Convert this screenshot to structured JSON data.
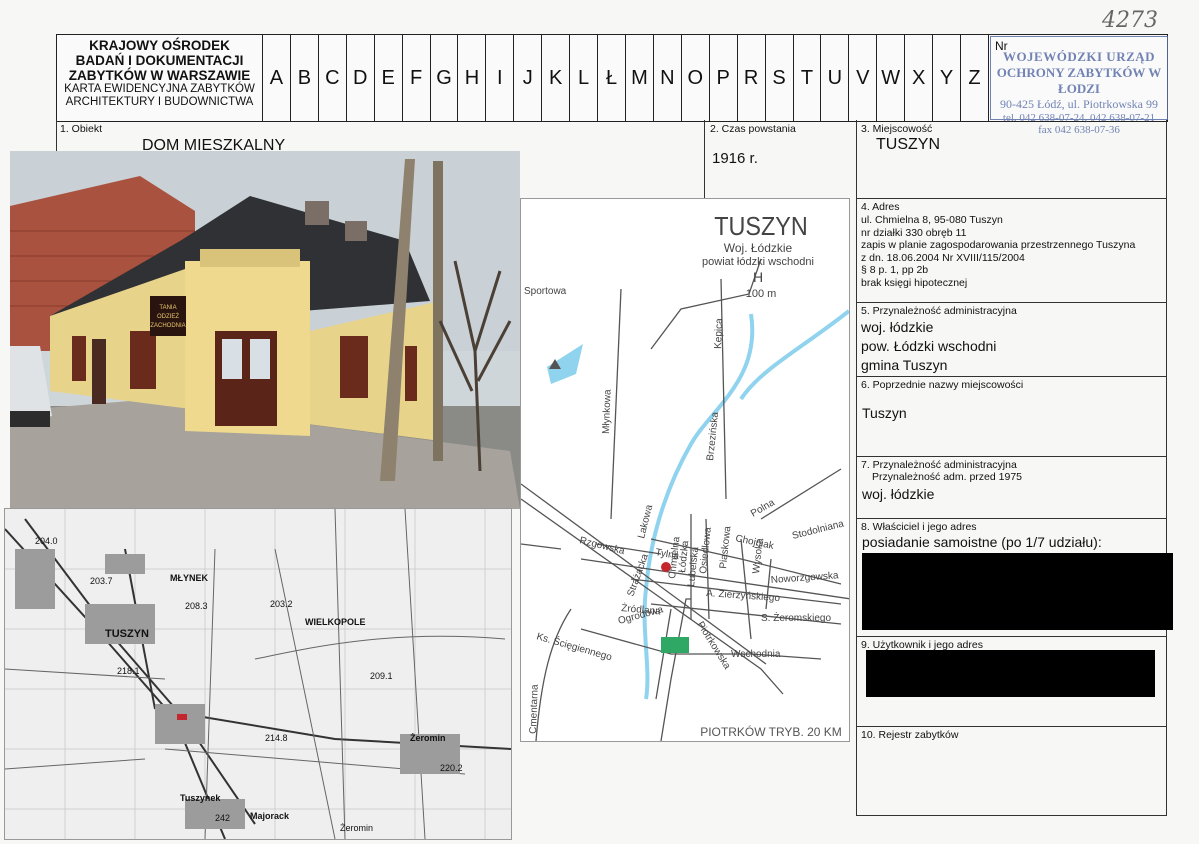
{
  "handwritten_number": "4273",
  "header": {
    "title_lines": [
      "KRAJOWY OŚRODEK",
      "BADAŃ I DOKUMENTACJI",
      "ZABYTKÓW W WARSZAWIE"
    ],
    "subtitle_lines": [
      "KARTA EWIDENCYJNA ZABYTKÓW",
      "ARCHITEKTURY I BUDOWNICTWA"
    ],
    "letters": [
      "A",
      "B",
      "C",
      "D",
      "E",
      "F",
      "G",
      "H",
      "I",
      "J",
      "K",
      "L",
      "Ł",
      "M",
      "N",
      "O",
      "P",
      "R",
      "S",
      "T",
      "U",
      "V",
      "W",
      "X",
      "Y",
      "Z"
    ],
    "nr_label": "Nr"
  },
  "stamp": {
    "line1": "WOJEWÓDZKI URZĄD",
    "line2": "OCHRONY ZABYTKÓW W ŁODZI",
    "line3": "90-425 Łódź, ul. Piotrkowska 99",
    "line4": "tel. 042 638-07-24, 042 638-07-21",
    "line5": "fax 042 638-07-36"
  },
  "fields": {
    "f1_label": "1. Obiekt",
    "f1_value": "DOM MIESZKALNY",
    "f2_label": "2. Czas powstania",
    "f2_value": "1916 r.",
    "f3_label": "3. Miejscowość",
    "f3_value": "TUSZYN",
    "f4_label": "4. Adres",
    "f4_lines": [
      "ul. Chmielna  8, 95-080 Tuszyn",
      "nr działki 330 obręb 11",
      "zapis w planie zagospodarowania przestrzennego Tuszyna",
      "z dn. 18.06.2004 Nr XVIII/115/2004",
      "§ 8 p. 1, pp 2b",
      "brak  księgi  hipotecznej"
    ],
    "f5_label": "5. Przynależność administracyjna",
    "f5_lines": [
      "woj. łódzkie",
      "pow. Łódzki wschodni",
      "gmina Tuszyn"
    ],
    "f6_label": "6. Poprzednie nazwy miejscowości",
    "f6_value": "Tuszyn",
    "f7_label": "7. Przynależność administracyjna",
    "f7_sublabel": "Przynależność adm. przed 1975",
    "f7_value": "woj. łódzkie",
    "f8_label": "8. Właściciel i jego adres",
    "f8_value": "posiadanie samoistne (po 1/7 udziału):",
    "f9_label": "9. Użytkownik i jego adres",
    "f10_label": "10. Rejestr zabytków"
  },
  "photo": {
    "shop_sign": [
      "TANIA",
      "ODZIEŻ",
      "ZACHODNIA"
    ]
  },
  "map": {
    "title": "TUSZYN",
    "sub1": "Woj. Łódzkie",
    "sub2": "powiat łódzki wschodni",
    "scale": "100 m",
    "footer": "PIOTRKÓW TRYB.  20 KM",
    "streets": [
      "Sportowa",
      "Młynkowa",
      "Kepica",
      "Brzezińska",
      "Polna",
      "Stodolniana",
      "Chojniak",
      "Noworzgowska",
      "Wysoka",
      "Piaskowa",
      "A. Zierzyńskiego",
      "S. Żeromskiego",
      "Wschodnia",
      "Piotrkowska",
      "Ks. Ścięgiennego",
      "Cmentarna",
      "Ogrodowa",
      "Żródlana",
      "Strażacka",
      "Lakowa",
      "Rzgowska",
      "Tylna",
      "Łódzka",
      "Chmielna",
      "Lubelska",
      "Osiedlowa"
    ]
  },
  "topo": {
    "labels": [
      "MŁYNEK",
      "TUSZYN",
      "WIELKOPOLE",
      "Żeromin",
      "Tuszynek",
      "Majorack",
      "204.0",
      "203.7",
      "208.3",
      "203.2",
      "209.1",
      "218.1",
      "214.8",
      "220.2",
      "242",
      "Żeromin"
    ]
  }
}
